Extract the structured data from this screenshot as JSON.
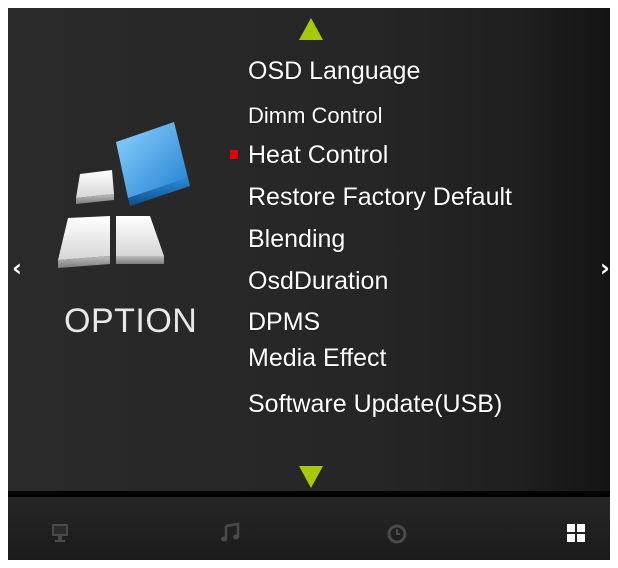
{
  "category": {
    "label": "OPTION",
    "icon": "option-blocks-icon"
  },
  "nav": {
    "left": "‹",
    "right": "›"
  },
  "menu": {
    "items": [
      {
        "label": "OSD Language"
      },
      {
        "label": "Dimm Control"
      },
      {
        "label": "Heat Control"
      },
      {
        "label": "Restore Factory Default"
      },
      {
        "label": "Blending"
      },
      {
        "label": "OsdDuration"
      },
      {
        "label": "DPMS"
      },
      {
        "label": "Media Effect"
      },
      {
        "label": "Software Update(USB)"
      }
    ],
    "selected_index": 2,
    "scroll_up_icon": "triangle-up-icon",
    "scroll_down_icon": "triangle-down-icon"
  },
  "bottom_bar": {
    "tabs": [
      {
        "icon": "monitor-icon"
      },
      {
        "icon": "music-note-icon"
      },
      {
        "icon": "clock-icon"
      },
      {
        "icon": "grid-icon",
        "active": true
      }
    ]
  },
  "colors": {
    "accent_arrow": "#a6c90b",
    "selected_marker": "#e10000",
    "icon_blue": "#3aa0e6"
  }
}
